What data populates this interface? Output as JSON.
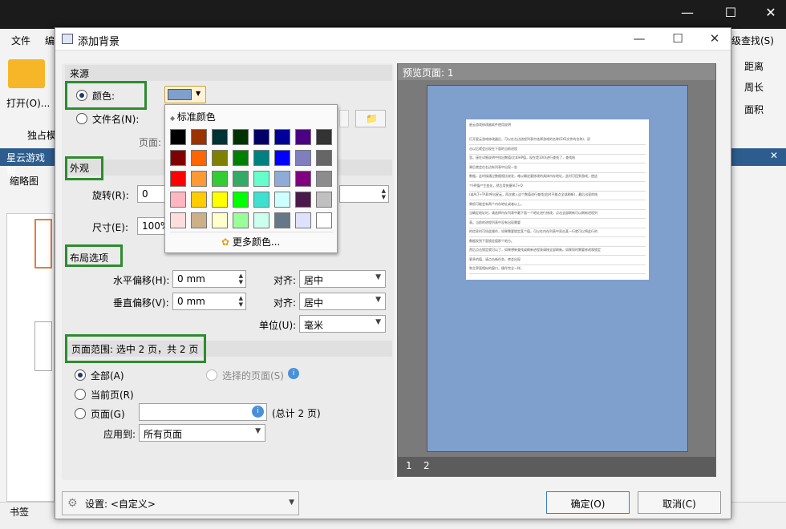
{
  "background": {
    "menu": [
      "文件",
      "编"
    ],
    "open_label": "打开(O)...",
    "exclusive_label": "独占模",
    "tab_label": "星云游戏帮",
    "thumbnails_label": "缩略图",
    "find_label": "级查找(S)",
    "right_tools": [
      "距离",
      "周长",
      "面积"
    ],
    "bookmarks_label": "书签"
  },
  "dialog": {
    "title": "添加背景",
    "source_header": "来源",
    "color_label": "颜色:",
    "file_label": "文件名(N):",
    "page_label": "页面:",
    "appearance_header": "外观",
    "rotate_label": "旋转(R):",
    "rotate_value": "0",
    "size_label": "尺寸(E):",
    "size_value": "100%",
    "layout_header": "布局选项",
    "h_offset_label": "水平偏移(H):",
    "h_offset_value": "0 mm",
    "v_offset_label": "垂直偏移(V):",
    "v_offset_value": "0 mm",
    "align_label": "对齐:",
    "align_h_value": "居中",
    "align_v_value": "居中",
    "unit_label": "单位(U):",
    "unit_value": "毫米",
    "range_header": "页面范围: 选中 2 页，共 2 页",
    "all_label": "全部(A)",
    "selected_pages_label": "选择的页面(S)",
    "current_page_label": "当前页(R)",
    "pages_label": "页面(G)",
    "total_label": "(总计 2 页)",
    "apply_to_label": "应用到:",
    "apply_to_value": "所有页面",
    "settings_label": "设置: <自定义>",
    "ok_label": "确定(O)",
    "cancel_label": "取消(C)"
  },
  "preview": {
    "header": "预览页面: 1",
    "tabs": [
      "1",
      "2"
    ],
    "doc_title": "星云游戏修改器软件使用说明",
    "doc_lines": [
      "打开星云游戏修改器后，可以在左边进程列表中选择游戏的名称(EXE文件的名称)，双",
      "击以后就会出现在下面的当前进程",
      "里。接在详细说明中找出数值(比如HP值，现在是100)进行查找了，查找结",
      "果后就会在右边有列表中出现一些",
      "数据。这时候通过数据相比较发，难以确定要修改的具体内存地址，此时可回到游戏，使这",
      "个HP值产生变化，然后用快捷ALT+Q",
      "(或ALT+TAB)呼出星云，再次输入这个数值进行查找(此时不能点全部刷新)，最后出现的结",
      "果很可能会有两个内存地址或者以上。",
      "当确定地址时，请选择内存列表中最下面一个地址进行修改，点击全部刷新可以刷新进程列",
      "表。当前的进程列表中没有出现需要",
      "的信息时可如此操作，如果需要锁定某个值，可以在内存列表中双击某一行就可以将此行的",
      "数据发到下面锁定值那个地方。",
      "然后点击锁定就可以了，如果想新查找或刷新进程表请按全部刷新。如果同时需要修改和锁定",
      "更多的值，请点击新任务，转会出现",
      "和主界面相似的窗口，操作完全一样。"
    ]
  },
  "color_popup": {
    "header": "标准颜色",
    "more_label": "更多颜色...",
    "swatches": [
      [
        "#000000",
        "#993300",
        "#003333",
        "#003300",
        "#000066",
        "#000099",
        "#4b0082",
        "#333333"
      ],
      [
        "#800000",
        "#ff6600",
        "#808000",
        "#008000",
        "#008080",
        "#0000ff",
        "#7f7fbf",
        "#666666"
      ],
      [
        "#ff0000",
        "#ff9933",
        "#33cc33",
        "#33aa66",
        "#66ffcc",
        "#8facd8",
        "#800080",
        "#8c8c8c"
      ],
      [
        "#ffb6c1",
        "#ffcc00",
        "#ffff00",
        "#00ff00",
        "#40e0d0",
        "#ccffff",
        "#4a1a4a",
        "#c0c0c0"
      ],
      [
        "#ffdddd",
        "#ccb088",
        "#ffffcc",
        "#99ff99",
        "#ccffee",
        "#667788",
        "#e0e0ff",
        "#ffffff"
      ]
    ],
    "current_color": "#7f9fcc"
  }
}
